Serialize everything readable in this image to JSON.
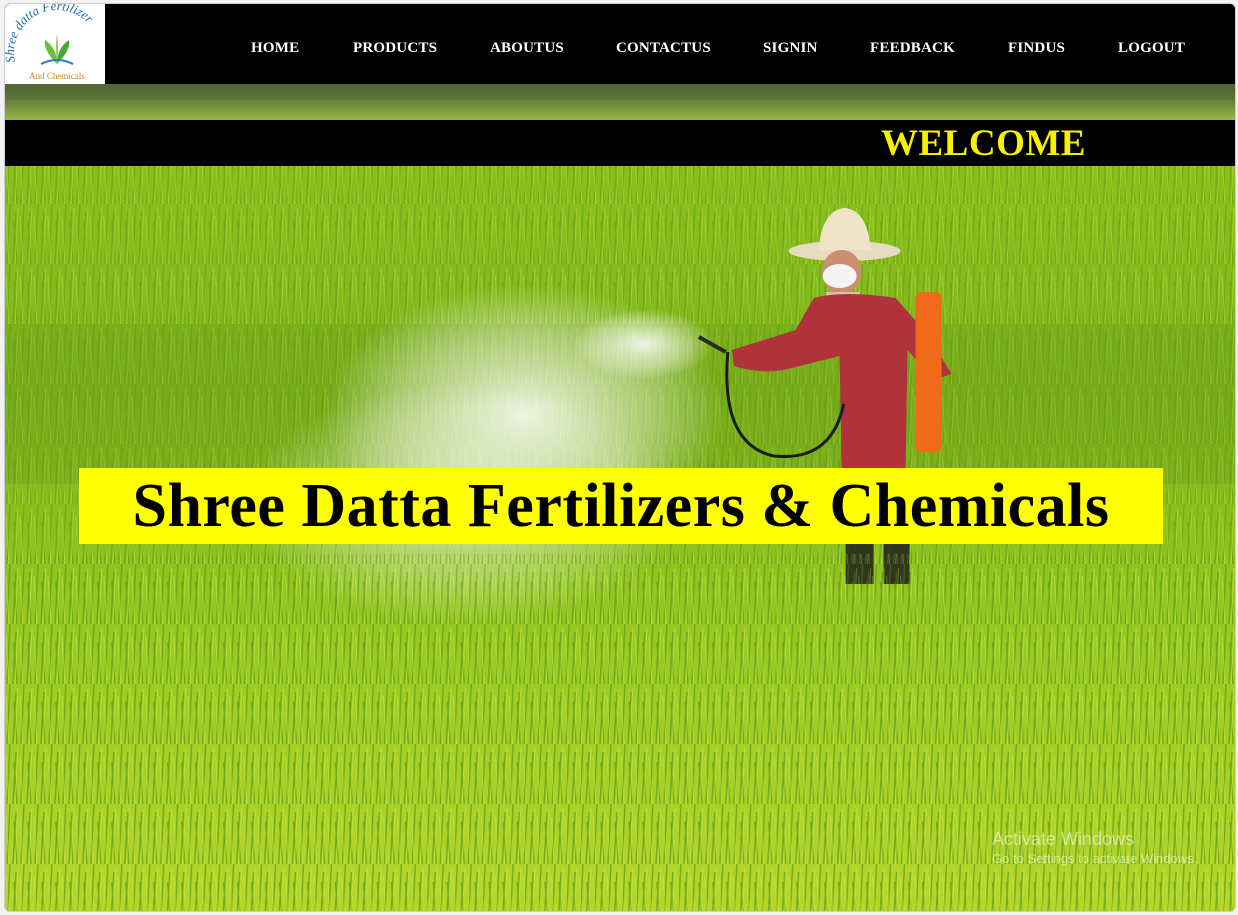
{
  "logo": {
    "line1": "Shree datta Fertilizer",
    "line2": "And Chemicals"
  },
  "nav": {
    "items": [
      {
        "label": "HOME"
      },
      {
        "label": "PRODUCTS"
      },
      {
        "label": "ABOUTUS"
      },
      {
        "label": "CONTACTUS"
      },
      {
        "label": "SIGNIN"
      },
      {
        "label": "FEEDBACK"
      },
      {
        "label": "FINDUS"
      },
      {
        "label": "LOGOUT"
      }
    ]
  },
  "welcome": "WELCOME",
  "hero": {
    "title": "Shree Datta Fertilizers & Chemicals"
  },
  "watermark": {
    "title": "Activate Windows",
    "subtitle": "Go to Settings to activate Windows."
  },
  "colors": {
    "nav_bg": "#000000",
    "nav_text": "#ffffff",
    "welcome_text": "#f5f100",
    "hero_bg": "#ffff00",
    "field_green": "#7db31f"
  }
}
